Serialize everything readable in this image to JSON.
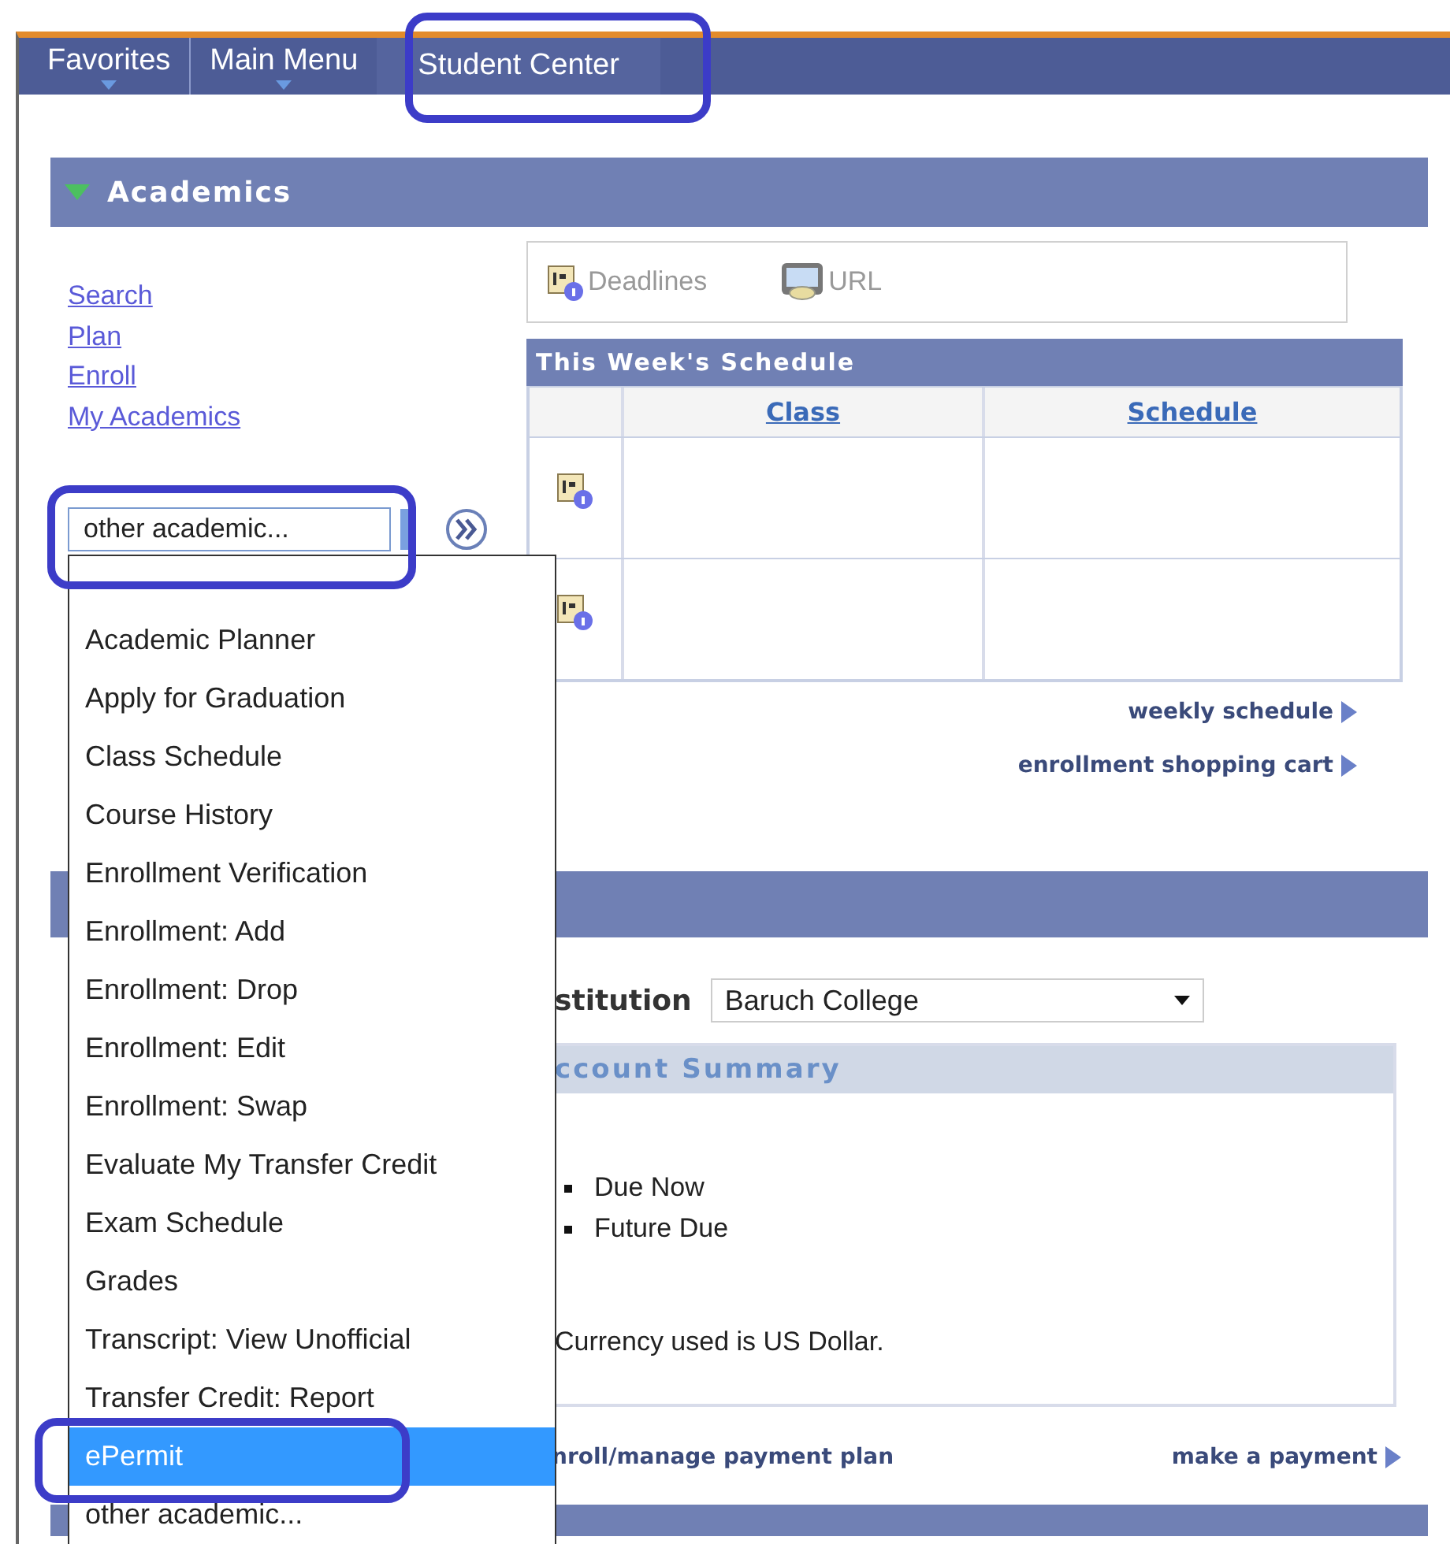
{
  "nav_tabs": [
    {
      "label": "Favorites",
      "menu": true,
      "selected": false
    },
    {
      "label": "Main Menu",
      "menu": true,
      "selected": false
    },
    {
      "label": "Student Center",
      "menu": false,
      "selected": true
    }
  ],
  "academics": {
    "title": "Academics",
    "expanded": true,
    "links": [
      "Search",
      "Plan",
      "Enroll",
      "My Academics"
    ],
    "select": {
      "value": "other academic..."
    },
    "toolbar": [
      {
        "label": "Deadlines",
        "kind": "calendar"
      },
      {
        "label": "URL",
        "kind": "url"
      }
    ],
    "schedule": {
      "title": "This Week's Schedule",
      "columns": [
        "Class",
        "Schedule"
      ],
      "rows": [
        {
          "kind": "calendar"
        },
        {
          "kind": "calendar"
        }
      ]
    },
    "links_right": [
      "weekly schedule",
      "enrollment shopping cart"
    ]
  },
  "dropdown": {
    "options": [
      {
        "label": "Academic Planner",
        "selected": false
      },
      {
        "label": "Apply for Graduation",
        "selected": false
      },
      {
        "label": "Class Schedule",
        "selected": false
      },
      {
        "label": "Course History",
        "selected": false
      },
      {
        "label": "Enrollment Verification",
        "selected": false
      },
      {
        "label": "Enrollment: Add",
        "selected": false
      },
      {
        "label": "Enrollment: Drop",
        "selected": false
      },
      {
        "label": "Enrollment: Edit",
        "selected": false
      },
      {
        "label": "Enrollment: Swap",
        "selected": false
      },
      {
        "label": "Evaluate My Transfer Credit",
        "selected": false
      },
      {
        "label": "Exam Schedule",
        "selected": false
      },
      {
        "label": "Grades",
        "selected": false
      },
      {
        "label": "Transcript: View Unofficial",
        "selected": false
      },
      {
        "label": "Transfer Credit: Report",
        "selected": false
      },
      {
        "label": "ePermit",
        "selected": true
      },
      {
        "label": "other academic...",
        "selected": false
      }
    ]
  },
  "finances": {
    "institution_label": "stitution",
    "institution": "Baruch College",
    "summary_title": "ccount Summary",
    "bullets": [
      "Due Now",
      "Future Due"
    ],
    "note": "Currency used is US Dollar.",
    "links": [
      "nroll/manage payment plan",
      "make a payment"
    ]
  }
}
